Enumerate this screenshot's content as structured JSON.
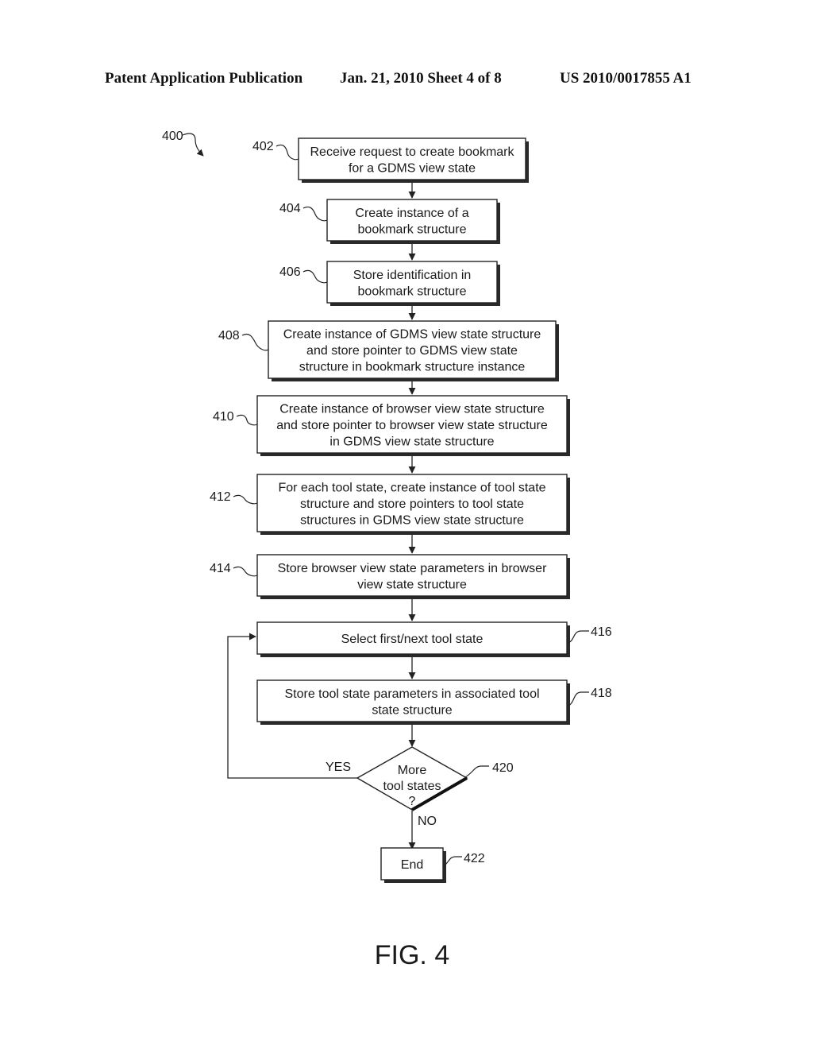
{
  "header": {
    "left": "Patent Application Publication",
    "middle": "Jan. 21, 2010  Sheet 4 of 8",
    "right": "US 2010/0017855 A1"
  },
  "diagram": {
    "ref": "400",
    "figure_label": "FIG. 4",
    "steps": [
      {
        "ref": "402",
        "lines": [
          "Receive request to create bookmark",
          "for a  GDMS view state"
        ]
      },
      {
        "ref": "404",
        "lines": [
          "Create instance of a",
          "bookmark structure"
        ]
      },
      {
        "ref": "406",
        "lines": [
          "Store identification in",
          "bookmark structure"
        ]
      },
      {
        "ref": "408",
        "lines": [
          "Create instance of GDMS view state structure",
          "and store pointer to GDMS view state",
          "structure in bookmark structure instance"
        ]
      },
      {
        "ref": "410",
        "lines": [
          "Create instance of browser view state structure",
          "and store pointer to browser view state structure",
          "in GDMS view state structure"
        ]
      },
      {
        "ref": "412",
        "lines": [
          "For each tool state, create instance of tool state",
          "structure and store pointers to tool state",
          "structures in GDMS view state structure"
        ]
      },
      {
        "ref": "414",
        "lines": [
          "Store browser view state parameters in browser",
          "view state structure"
        ]
      },
      {
        "ref": "416",
        "lines": [
          "Select first/next tool state"
        ]
      },
      {
        "ref": "418",
        "lines": [
          "Store tool state parameters in associated tool",
          "state structure"
        ]
      }
    ],
    "decision": {
      "ref": "420",
      "lines": [
        "More",
        "tool states",
        "?"
      ],
      "yes_label": "YES",
      "no_label": "NO"
    },
    "end": {
      "ref": "422",
      "label": "End"
    }
  }
}
